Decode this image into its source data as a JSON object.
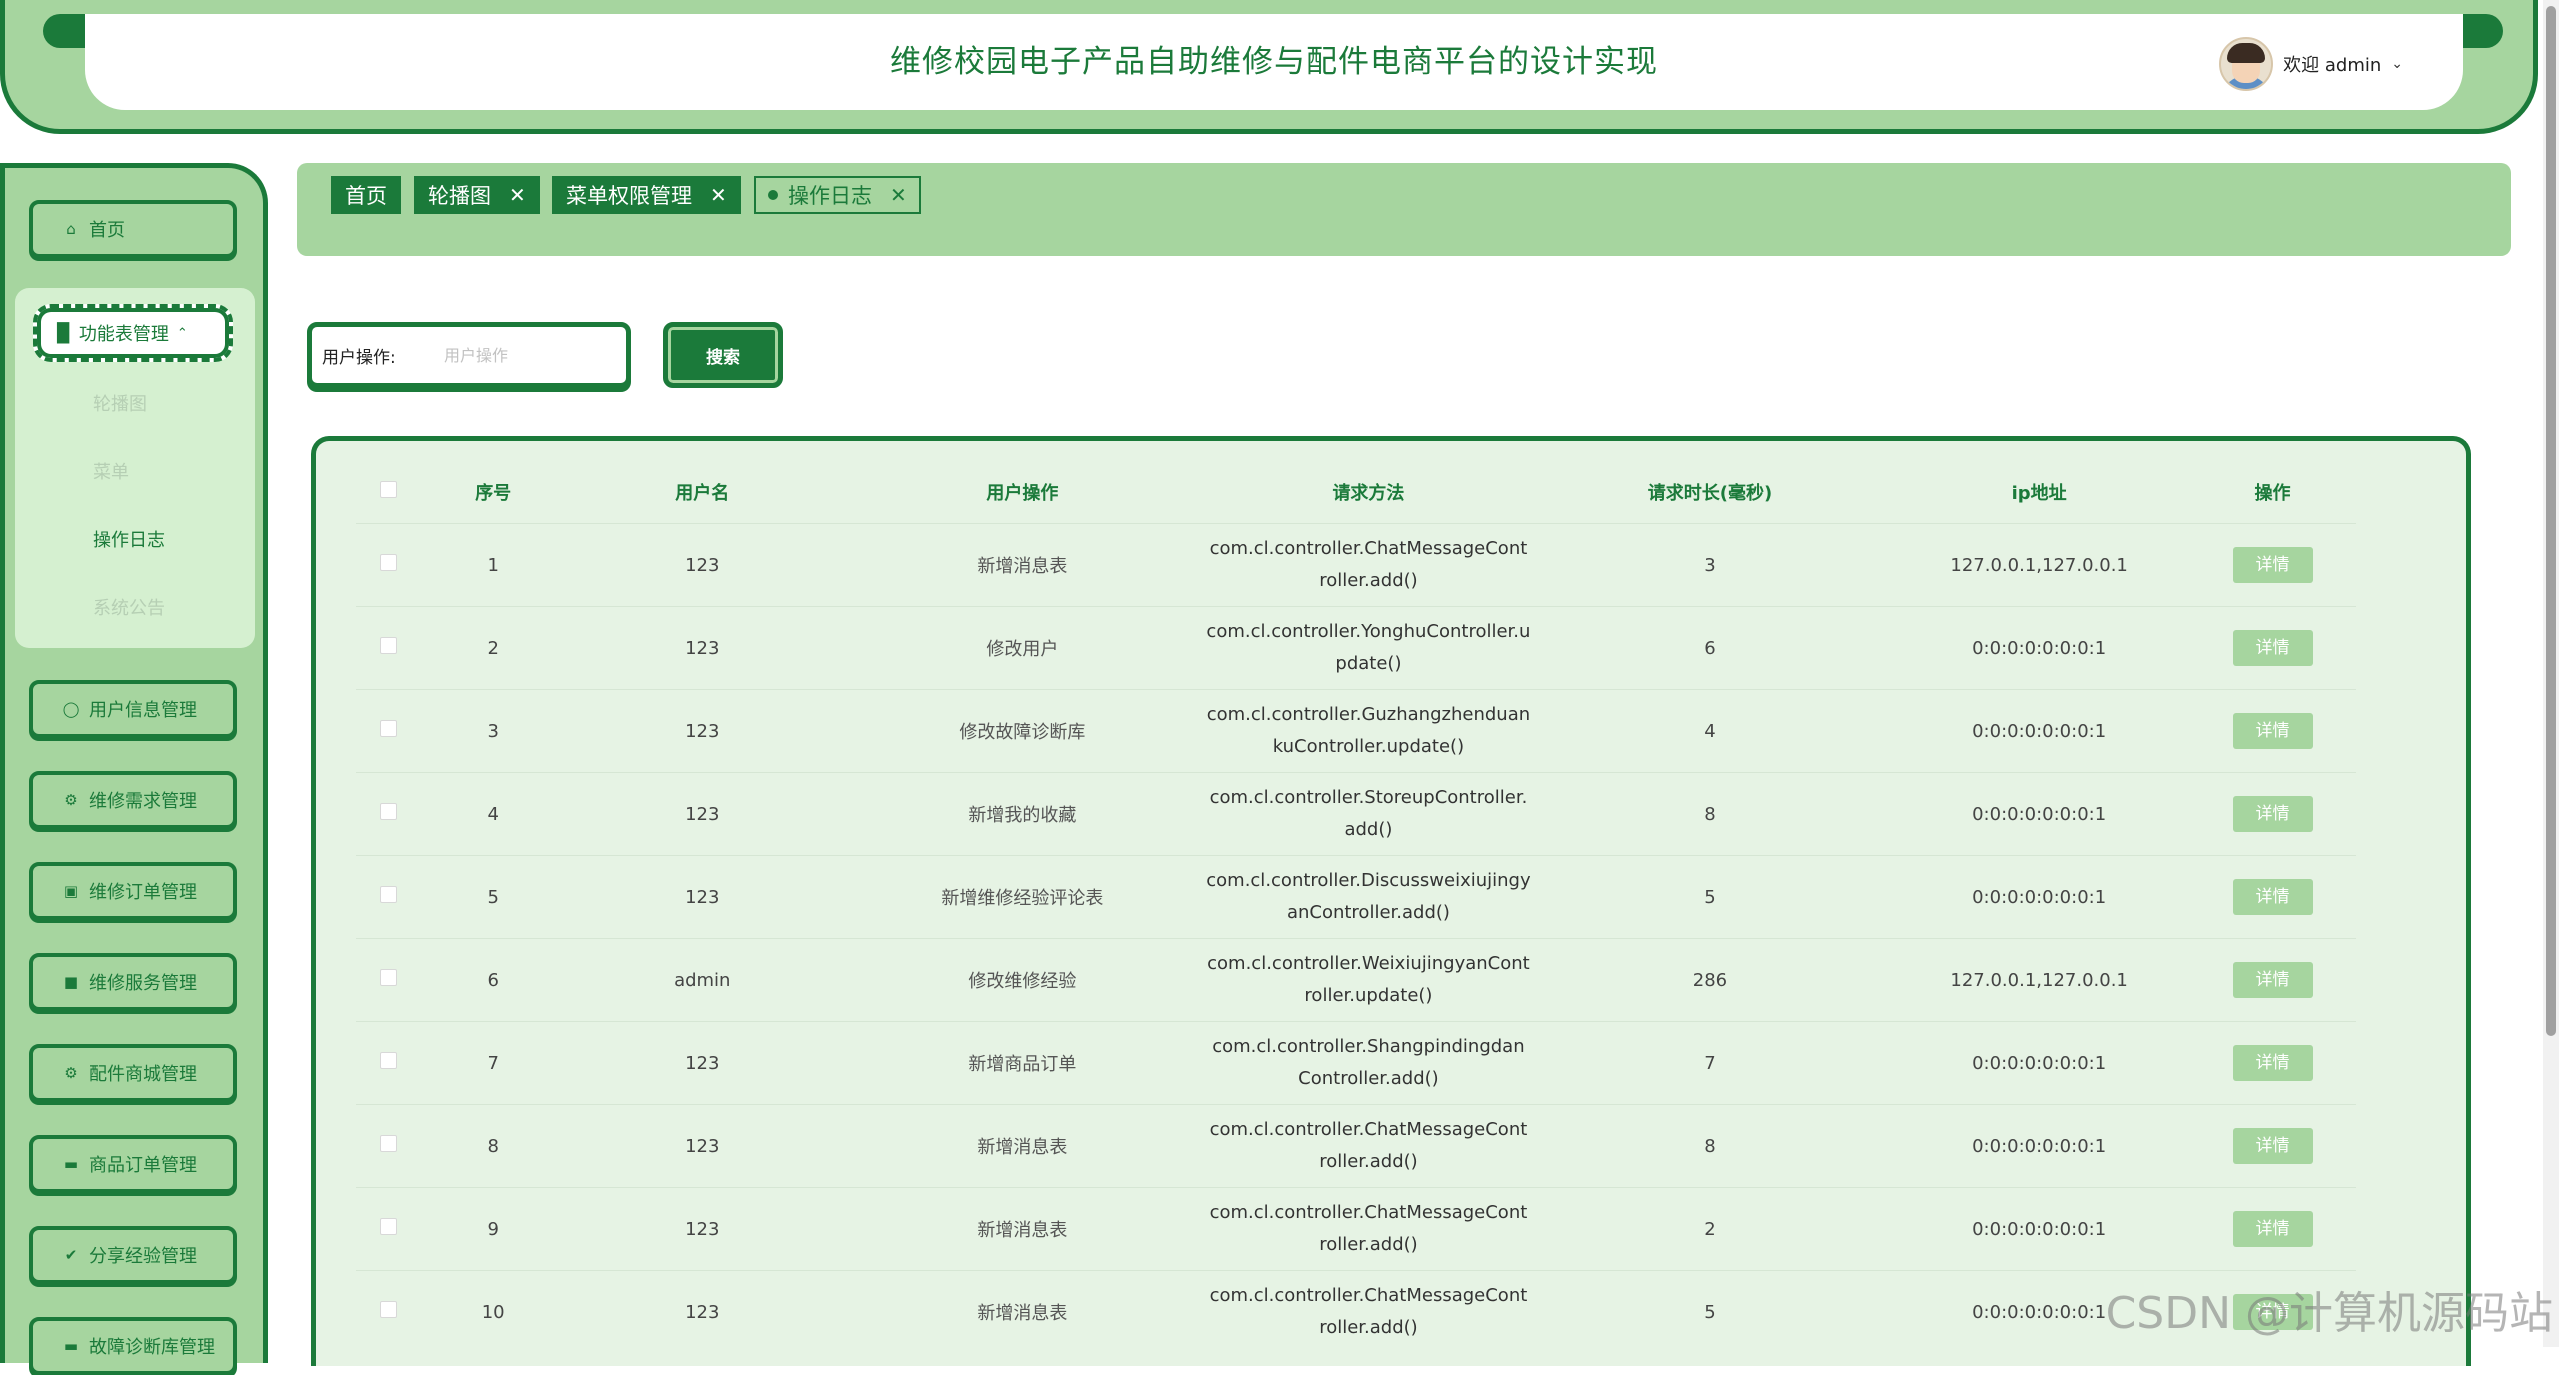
{
  "header": {
    "title": "维修校园电子产品自助维修与配件电商平台的设计实现",
    "welcome": "欢迎 admin"
  },
  "sidebar": {
    "home": "首页",
    "group": "功能表管理",
    "sub_items": [
      "轮播图",
      "菜单",
      "操作日志",
      "系统公告"
    ],
    "items": [
      "用户信息管理",
      "维修需求管理",
      "维修订单管理",
      "维修服务管理",
      "配件商城管理",
      "商品订单管理",
      "分享经验管理",
      "故障诊断库管理"
    ]
  },
  "tabs": [
    "首页",
    "轮播图",
    "菜单权限管理",
    "操作日志"
  ],
  "search": {
    "label": "用户操作:",
    "placeholder": "用户操作",
    "button": "搜索"
  },
  "table": {
    "headers": [
      "序号",
      "用户名",
      "用户操作",
      "请求方法",
      "请求时长(毫秒)",
      "ip地址",
      "操作"
    ],
    "detail_label": "详情",
    "rows": [
      {
        "no": "1",
        "user": "123",
        "op": "新增消息表",
        "m1": "com.cl.controller.ChatMessageCont",
        "m2": "roller.add()",
        "dur": "3",
        "ip": "127.0.0.1,127.0.0.1"
      },
      {
        "no": "2",
        "user": "123",
        "op": "修改用户",
        "m1": "com.cl.controller.YonghuController.u",
        "m2": "pdate()",
        "dur": "6",
        "ip": "0:0:0:0:0:0:0:1"
      },
      {
        "no": "3",
        "user": "123",
        "op": "修改故障诊断库",
        "m1": "com.cl.controller.Guzhangzhenduan",
        "m2": "kuController.update()",
        "dur": "4",
        "ip": "0:0:0:0:0:0:0:1"
      },
      {
        "no": "4",
        "user": "123",
        "op": "新增我的收藏",
        "m1": "com.cl.controller.StoreupController.",
        "m2": "add()",
        "dur": "8",
        "ip": "0:0:0:0:0:0:0:1"
      },
      {
        "no": "5",
        "user": "123",
        "op": "新增维修经验评论表",
        "m1": "com.cl.controller.Discussweixiujingy",
        "m2": "anController.add()",
        "dur": "5",
        "ip": "0:0:0:0:0:0:0:1"
      },
      {
        "no": "6",
        "user": "admin",
        "op": "修改维修经验",
        "m1": "com.cl.controller.WeixiujingyanCont",
        "m2": "roller.update()",
        "dur": "286",
        "ip": "127.0.0.1,127.0.0.1"
      },
      {
        "no": "7",
        "user": "123",
        "op": "新增商品订单",
        "m1": "com.cl.controller.Shangpindingdan",
        "m2": "Controller.add()",
        "dur": "7",
        "ip": "0:0:0:0:0:0:0:1"
      },
      {
        "no": "8",
        "user": "123",
        "op": "新增消息表",
        "m1": "com.cl.controller.ChatMessageCont",
        "m2": "roller.add()",
        "dur": "8",
        "ip": "0:0:0:0:0:0:0:1"
      },
      {
        "no": "9",
        "user": "123",
        "op": "新增消息表",
        "m1": "com.cl.controller.ChatMessageCont",
        "m2": "roller.add()",
        "dur": "2",
        "ip": "0:0:0:0:0:0:0:1"
      },
      {
        "no": "10",
        "user": "123",
        "op": "新增消息表",
        "m1": "com.cl.controller.ChatMessageCont",
        "m2": "roller.add()",
        "dur": "5",
        "ip": "0:0:0:0:0:0:0:1"
      }
    ]
  },
  "watermark": "CSDN @计算机源码站"
}
